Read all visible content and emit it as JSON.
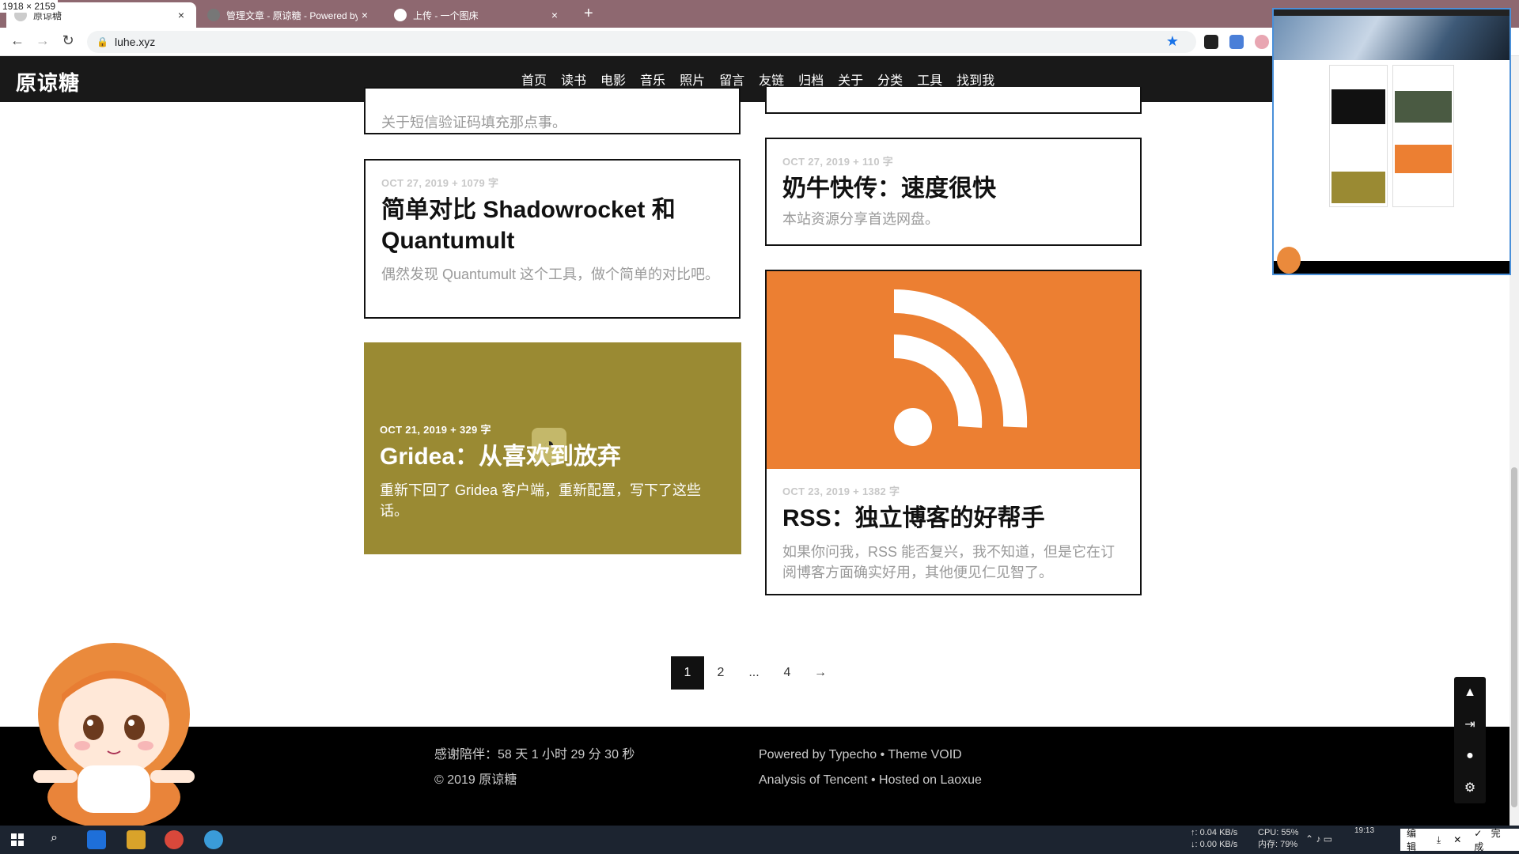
{
  "window": {
    "dimension_label": "1918 × 2159"
  },
  "tabs": [
    {
      "title": "原谅糖",
      "close": "×"
    },
    {
      "title": "管理文章 - 原谅糖 - Powered by",
      "close": "×"
    },
    {
      "title": "上传 - 一个图床",
      "close": "×"
    }
  ],
  "new_tab_symbol": "+",
  "address": {
    "url": "luhe.xyz"
  },
  "site": {
    "brand": "原谅糖",
    "nav": [
      "首页",
      "读书",
      "电影",
      "音乐",
      "照片",
      "留言",
      "友链",
      "归档",
      "关于",
      "分类",
      "工具",
      "找到我"
    ]
  },
  "posts": [
    {
      "meta": "",
      "title": "",
      "excerpt": "关于短信验证码填充那点事。"
    },
    {
      "meta": "OCT 27, 2019 + 1079 字",
      "title": "简单对比 Shadowrocket 和 Quantumult",
      "excerpt": "偶然发现 Quantumult 这个工具，做个简单的对比吧。"
    },
    {
      "meta": "OCT 21, 2019 + 329 字",
      "title": "Gridea：从喜欢到放弃",
      "excerpt": "重新下回了 Gridea 客户端，重新配置，写下了这些话。"
    },
    {
      "meta": "OCT 27, 2019 + 110 字",
      "title": "奶牛快传：速度很快",
      "excerpt": "本站资源分享首选网盘。"
    },
    {
      "meta": "OCT 23, 2019 + 1382 字",
      "title": "RSS：独立博客的好帮手",
      "excerpt": "如果你问我，RSS 能否复兴，我不知道，但是它在订阅博客方面确实好用，其他便见仁见智了。"
    }
  ],
  "pagination": {
    "items": [
      "1",
      "2",
      "...",
      "4",
      "→"
    ],
    "current": "1"
  },
  "footer": {
    "uptime": "感谢陪伴：58 天 1 小时 29 分 30 秒",
    "copyright": "© 2019 原谅糖",
    "powered": "Powered by Typecho • Theme VOID",
    "hosted": "Analysis of Tencent • Hosted on Laoxue"
  },
  "taskbar": {
    "net_up": "↑: 0.04 KB/s",
    "net_down": "↓: 0.00 KB/s",
    "cpu": "CPU: 55%",
    "mem": "内存: 79%",
    "time": "19:13",
    "edit_label": "编辑",
    "done_label": "完成"
  },
  "colors": {
    "rss_orange": "#ec7f32",
    "olive_card": "#9a8a33",
    "header_bg": "#191919"
  }
}
